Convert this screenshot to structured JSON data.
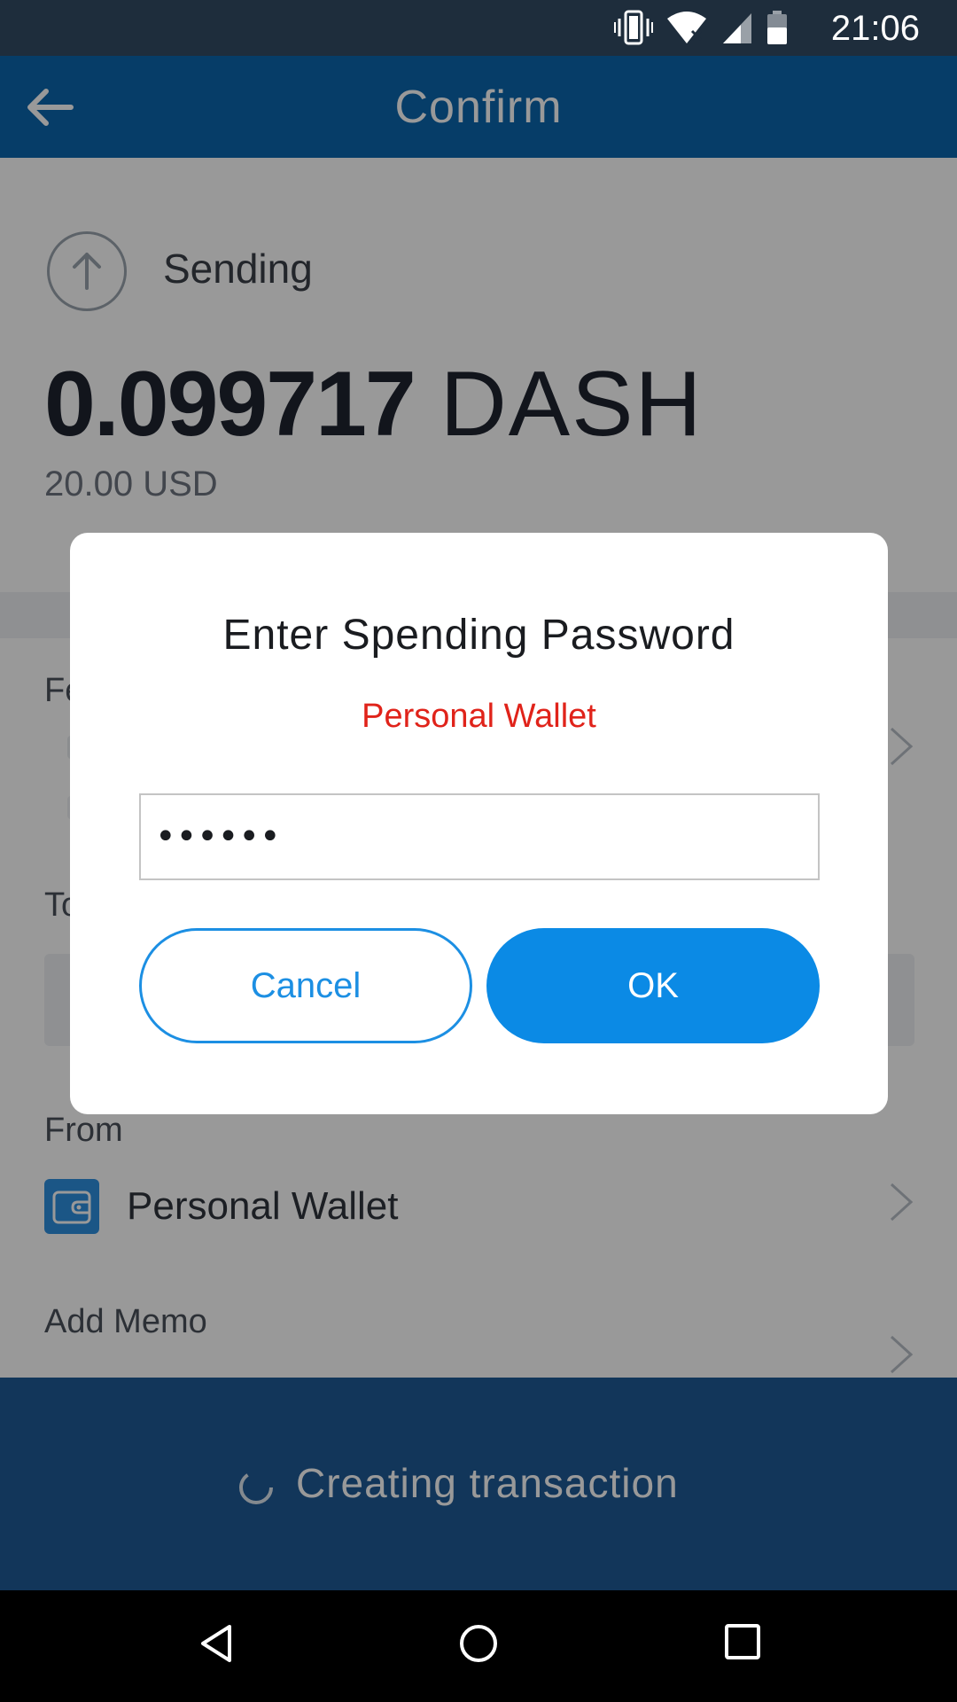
{
  "status_bar": {
    "time": "21:06",
    "icons": [
      "vibrate-icon",
      "wifi-icon",
      "cell-signal-icon",
      "battery-icon"
    ]
  },
  "header": {
    "title": "Confirm",
    "back_icon": "back-arrow-icon"
  },
  "sending": {
    "label": "Sending",
    "amount_value": "0.099717",
    "amount_unit": "DASH",
    "fiat": "20.00 USD"
  },
  "fee": {
    "label": "Fe"
  },
  "to": {
    "label": "To"
  },
  "from": {
    "label": "From",
    "wallet_name": "Personal Wallet"
  },
  "memo": {
    "label": "Add Memo"
  },
  "footer": {
    "status_text": "Creating transaction"
  },
  "dialog": {
    "title": "Enter Spending Password",
    "wallet_name": "Personal Wallet",
    "password_value": "••••••",
    "cancel_label": "Cancel",
    "ok_label": "OK"
  },
  "colors": {
    "header": "#0b67ad",
    "accent": "#0b8ae5",
    "error_red": "#e0231a",
    "footer": "#1e5a96"
  }
}
